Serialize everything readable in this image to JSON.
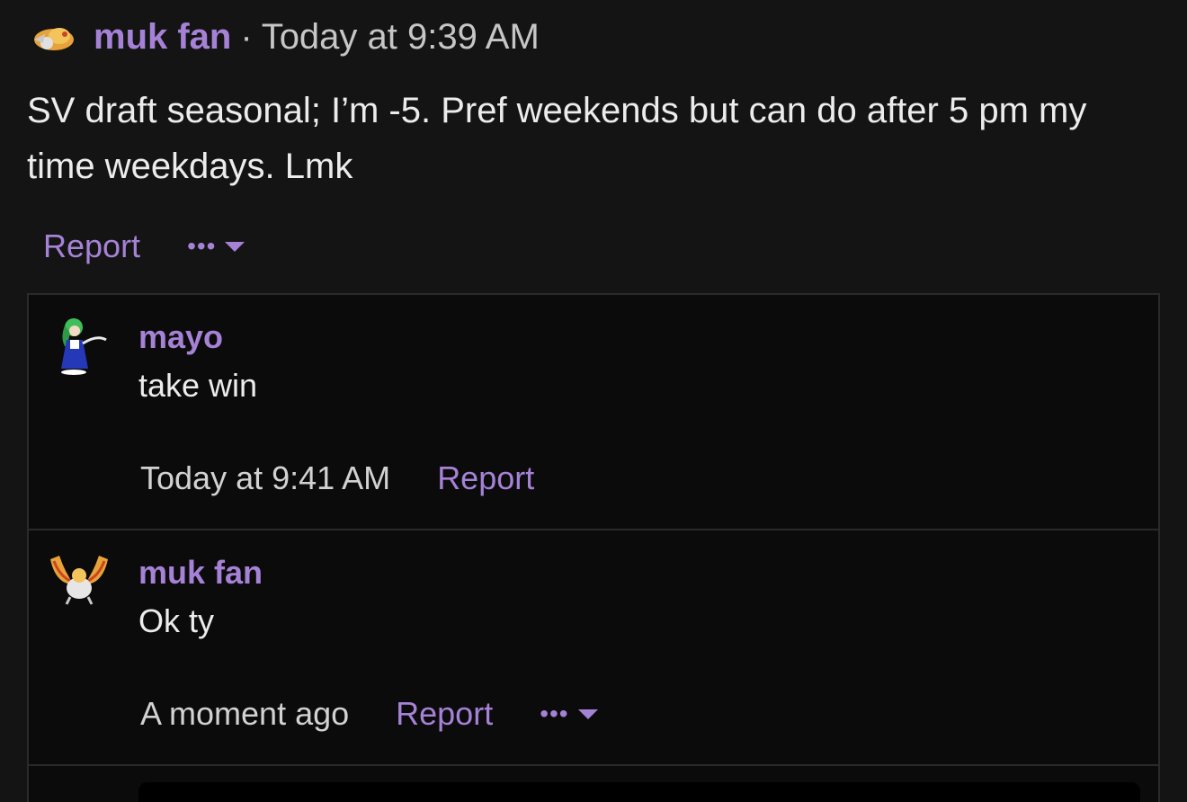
{
  "post": {
    "author": "muk fan",
    "separator": "·",
    "time": "Today at 9:39 AM",
    "body": "SV draft seasonal; I’m -5. Pref weekends but can do after 5 pm my time weekdays. Lmk",
    "report_label": "Report",
    "more_label": "•••"
  },
  "replies": [
    {
      "author": "mayo",
      "text": "take win",
      "time": "Today at 9:41 AM",
      "report_label": "Report"
    },
    {
      "author": "muk fan",
      "text": "Ok ty",
      "time": "A moment ago",
      "report_label": "Report",
      "more_label": "•••"
    }
  ],
  "colors": {
    "background": "#141414",
    "accent": "#a582d6",
    "text": "#ececec",
    "panel": "#0b0b0b"
  }
}
